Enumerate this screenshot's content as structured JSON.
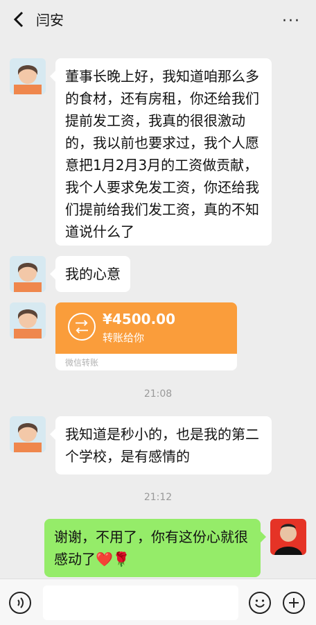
{
  "header": {
    "title": "闫安",
    "back_icon": "back-arrow-icon",
    "more_icon": "more-dots-icon",
    "more_text": "···"
  },
  "messages": [
    {
      "text": "董事长晚上好，我知道咱那么多的食材，还有房租，你还给我们提前发工资，我真的很很激动的，我以前也要求过，我个人愿意把1月2月3月的工资做贡献，我个人要求免发工资，你还给我们提前给我们发工资，真的不知道说什么了"
    },
    {
      "text": "我的心意"
    },
    {
      "text": "我知道是秒小的，也是我的第二个学校，是有感情的"
    },
    {
      "text": "谢谢，不用了，你有这份心就很感动了❤️🌹"
    }
  ],
  "transfer": {
    "amount": "¥4500.00",
    "note": "转账给你",
    "label": "微信转账"
  },
  "times": [
    "21:08",
    "21:12"
  ],
  "bottom": {
    "voice_icon": "voice-icon",
    "emoji_icon": "emoji-icon",
    "plus_icon": "plus-icon"
  }
}
